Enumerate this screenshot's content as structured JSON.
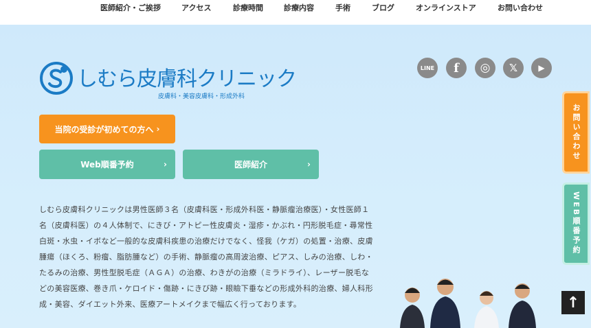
{
  "nav": {
    "items": [
      "医師紹介・ご挨拶",
      "アクセス",
      "診療時間",
      "診療内容",
      "手術",
      "ブログ",
      "オンラインストア",
      "お問い合わせ"
    ]
  },
  "logo": {
    "name": "しむら皮膚科クリニック",
    "subtitle": "皮膚科・美容皮膚科・形成外科"
  },
  "social": [
    {
      "icon": "line-icon",
      "glyph": "LINE"
    },
    {
      "icon": "facebook-icon",
      "glyph": "f"
    },
    {
      "icon": "instagram-icon",
      "glyph": "◎"
    },
    {
      "icon": "x-icon",
      "glyph": "𝕏"
    },
    {
      "icon": "youtube-icon",
      "glyph": "▶"
    }
  ],
  "buttons": {
    "first_visit": "当院の受診が初めての方へ",
    "web_reserve": "Web順番予約",
    "doctors": "医師紹介",
    "chevron": "›"
  },
  "intro": "しむら皮膚科クリニックは男性医師３名（皮膚科医・形成外科医・静脈瘤治療医）・女性医師１名（皮膚科医）の４人体制で、にきび・アトピー性皮膚炎・湿疹・かぶれ・円形脱毛症・尋常性白斑・水虫・イボなど一般的な皮膚科疾患の治療だけでなく、怪我（ケガ）の処置・治療、皮膚腫瘍（ほくろ、粉瘤、脂肪腫など）の手術、静脈瘤の高周波治療、ピアス、しみの治療、しわ・たるみの治療、男性型脱毛症（ＡＧＡ）の治療、わきがの治療（ミラドライ）、レーザー脱毛などの美容医療、巻き爪・ケロイド・傷跡・にきび跡・眼瞼下垂などの形成外科的治療、婦人科形成・美容、ダイエット外来、医療アートメイクまで幅広く行っております。",
  "side_tabs": {
    "contact": "お問い合わせ",
    "web": "WEB順番予約"
  },
  "to_top": "↑",
  "colors": {
    "orange": "#f7931e",
    "teal": "#5fbfa7",
    "brand_blue": "#1b7bc5",
    "hero_bg": "#d3ecfb"
  }
}
